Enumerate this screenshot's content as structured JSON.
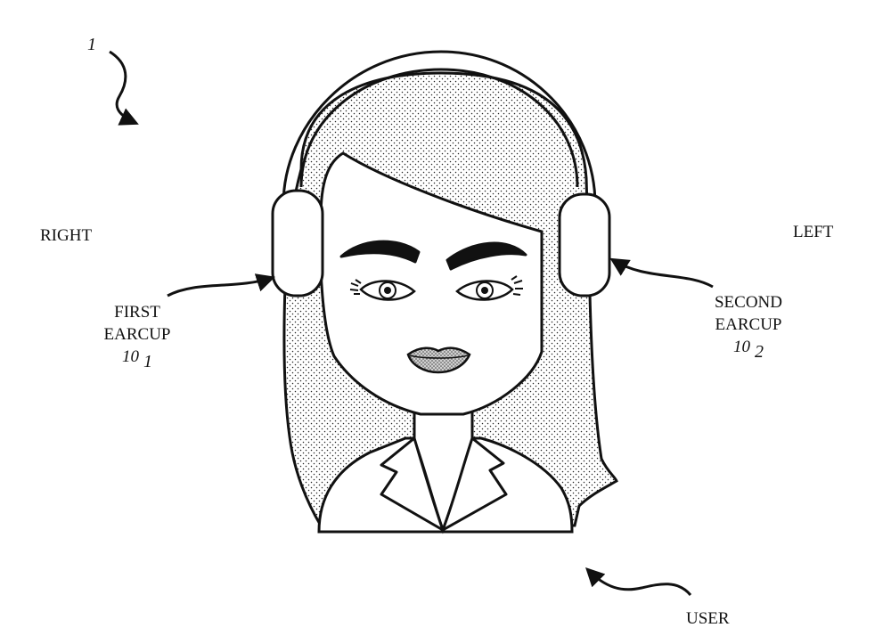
{
  "figure": {
    "ref_numeral": "1",
    "labels": {
      "right": "RIGHT",
      "left": "LEFT",
      "user": "USER",
      "first_earcup_line1": "FIRST",
      "first_earcup_line2": "EARCUP",
      "first_earcup_ref": "10",
      "first_earcup_sub": "1",
      "second_earcup_line1": "SECOND",
      "second_earcup_line2": "EARCUP",
      "second_earcup_ref": "10",
      "second_earcup_sub": "2"
    }
  }
}
